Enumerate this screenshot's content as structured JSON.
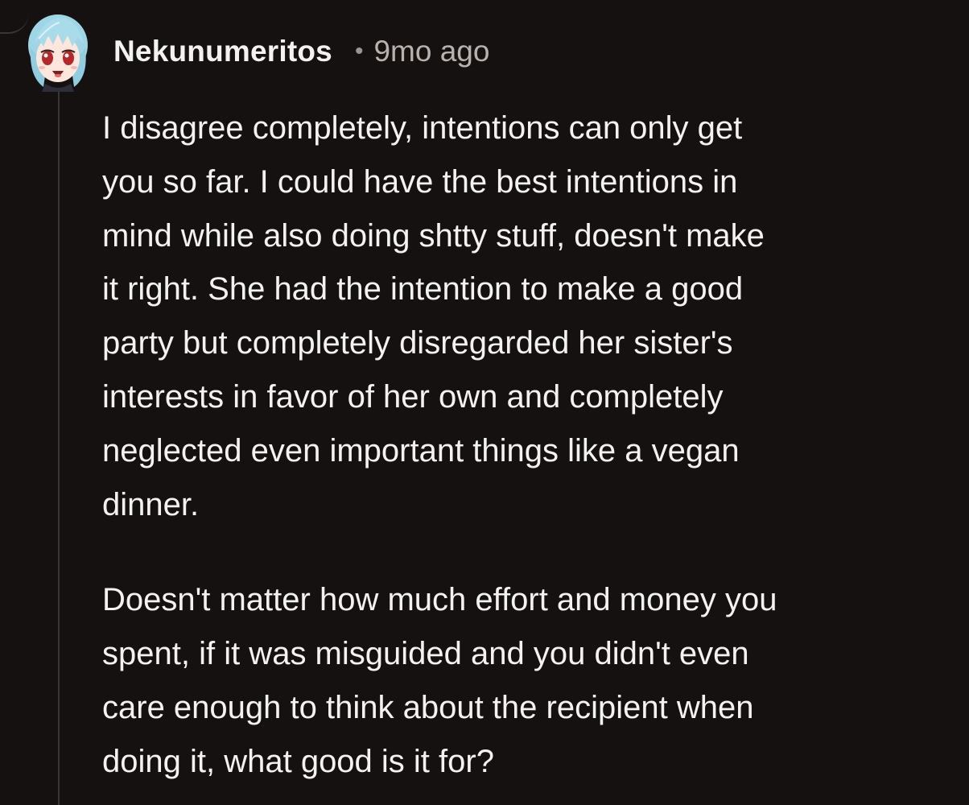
{
  "comment": {
    "author": "Nekunumeritos",
    "separator": "•",
    "timestamp": "9mo ago",
    "avatar_icon": "anime-girl-avatar-icon",
    "paragraphs": [
      {
        "lines": [
          "I disagree completely, intentions can only get",
          "you so far. I could have the best intentions in",
          "mind while also doing shtty stuff, doesn't make",
          "it right. She had the intention to make a good",
          "party but completely disregarded her sister's",
          "interests in favor of her own and completely",
          "neglected even important things like a vegan",
          "dinner."
        ]
      },
      {
        "lines": [
          "Doesn't matter how much effort and money you",
          "spent, if it was misguided and you didn't even",
          "care enough to think about the recipient when",
          "doing it, what good is it for?"
        ]
      }
    ]
  },
  "colors": {
    "background": "#141110",
    "text": "#f4f2f1",
    "meta_text": "#b8b1ad",
    "thread_line": "#3a3635"
  }
}
